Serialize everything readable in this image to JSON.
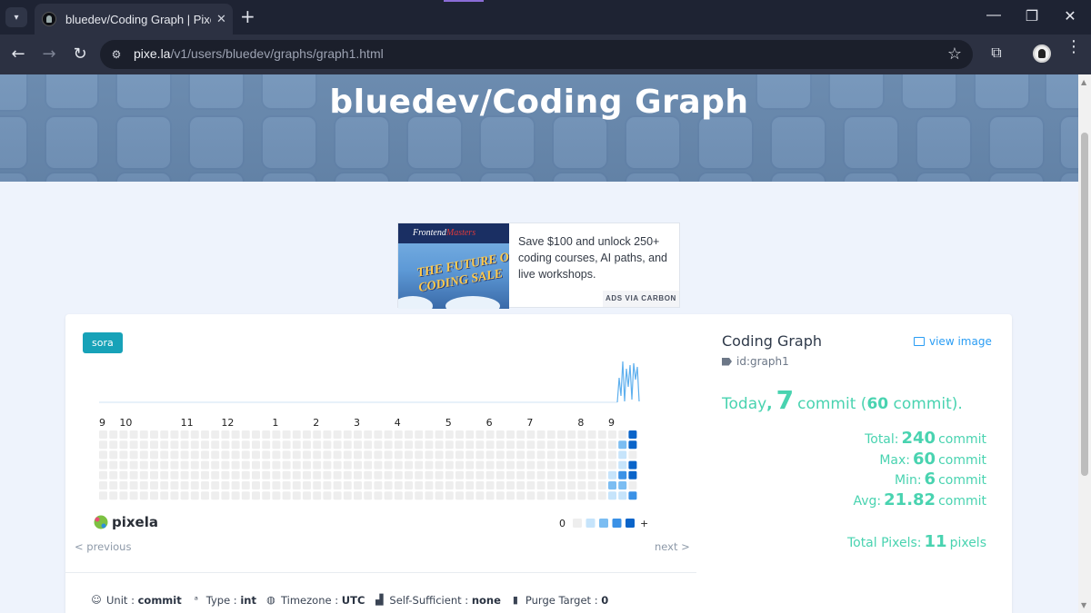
{
  "browser": {
    "tab_title": "bluedev/Coding Graph | Pixela",
    "url_host": "pixe.la",
    "url_path": "/v1/users/bluedev/graphs/graph1.html"
  },
  "page": {
    "hero_title": "bluedev/Coding Graph"
  },
  "ad": {
    "brand_a": "Frontend",
    "brand_b": "Masters",
    "headline_1": "THE FUTURE OF",
    "headline_2": "CODING SALE",
    "text": "Save $100 and unlock 250+ coding courses, AI paths, and live workshops.",
    "via": "ADS VIA CARBON"
  },
  "graph": {
    "color_badge": "sora",
    "month_labels": [
      "9",
      "10",
      "11",
      "12",
      "1",
      "2",
      "3",
      "4",
      "5",
      "6",
      "7",
      "8",
      "9"
    ],
    "legend_min": "0",
    "legend_max": "+",
    "logo_text": "pixela",
    "prev": "< previous",
    "next": "next >",
    "colors": {
      "empty": "#eeeeee",
      "level1": "#c6e4fb",
      "level2": "#7bbdf2",
      "level3": "#3a91e6",
      "level4": "#0a64c9"
    },
    "active_cells": [
      {
        "week": 50,
        "day": 4,
        "level": 1
      },
      {
        "week": 50,
        "day": 5,
        "level": 2
      },
      {
        "week": 50,
        "day": 6,
        "level": 1
      },
      {
        "week": 51,
        "day": 1,
        "level": 2
      },
      {
        "week": 51,
        "day": 2,
        "level": 1
      },
      {
        "week": 51,
        "day": 3,
        "level": 1
      },
      {
        "week": 51,
        "day": 4,
        "level": 3
      },
      {
        "week": 51,
        "day": 5,
        "level": 2
      },
      {
        "week": 51,
        "day": 6,
        "level": 1
      },
      {
        "week": 52,
        "day": 0,
        "level": 4
      },
      {
        "week": 52,
        "day": 1,
        "level": 4
      },
      {
        "week": 52,
        "day": 3,
        "level": 4
      },
      {
        "week": 52,
        "day": 4,
        "level": 4
      },
      {
        "week": 52,
        "day": 6,
        "level": 3
      }
    ]
  },
  "meta": {
    "unit_label": "Unit",
    "unit_value": "commit",
    "type_label": "Type",
    "type_value": "int",
    "timezone_label": "Timezone",
    "timezone_value": "UTC",
    "self_sufficient_label": "Self-Sufficient",
    "self_sufficient_value": "none",
    "purge_label": "Purge Target",
    "purge_value": "0"
  },
  "info": {
    "name": "Coding Graph",
    "view_image": "view image",
    "id": "id:graph1",
    "today_label": "Today",
    "today_value": "7",
    "today_unit": "commit",
    "today_paren_open": "(",
    "today_paren_value": "60",
    "today_paren_unit": "commit).",
    "total_label": "Total:",
    "total_value": "240",
    "max_label": "Max:",
    "max_value": "60",
    "min_label": "Min:",
    "min_value": "6",
    "avg_label": "Avg:",
    "avg_value": "21.82",
    "stat_unit": "commit",
    "total_pixels_label": "Total Pixels:",
    "total_pixels_value": "11",
    "total_pixels_unit": "pixels"
  }
}
